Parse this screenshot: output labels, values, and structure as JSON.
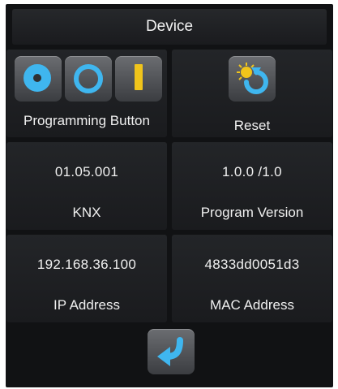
{
  "header": {
    "title": "Device"
  },
  "programming": {
    "label": "Programming Button"
  },
  "reset": {
    "label": "Reset"
  },
  "knx": {
    "value": "01.05.001",
    "label": "KNX"
  },
  "program_version": {
    "value": "1.0.0 /1.0",
    "label": "Program Version"
  },
  "ip": {
    "value": "192.168.36.100",
    "label": "IP Address"
  },
  "mac": {
    "value": "4833dd0051d3",
    "label": "MAC Address"
  },
  "icons": {
    "programming": [
      "led-on-icon",
      "led-off-icon",
      "toggle-bar-icon"
    ],
    "reset": "reset-arrow-icon",
    "back": "back-arrow-icon"
  },
  "colors": {
    "accent_blue": "#3fb6ef",
    "accent_yellow": "#f0c41b",
    "panel": "#111214"
  }
}
